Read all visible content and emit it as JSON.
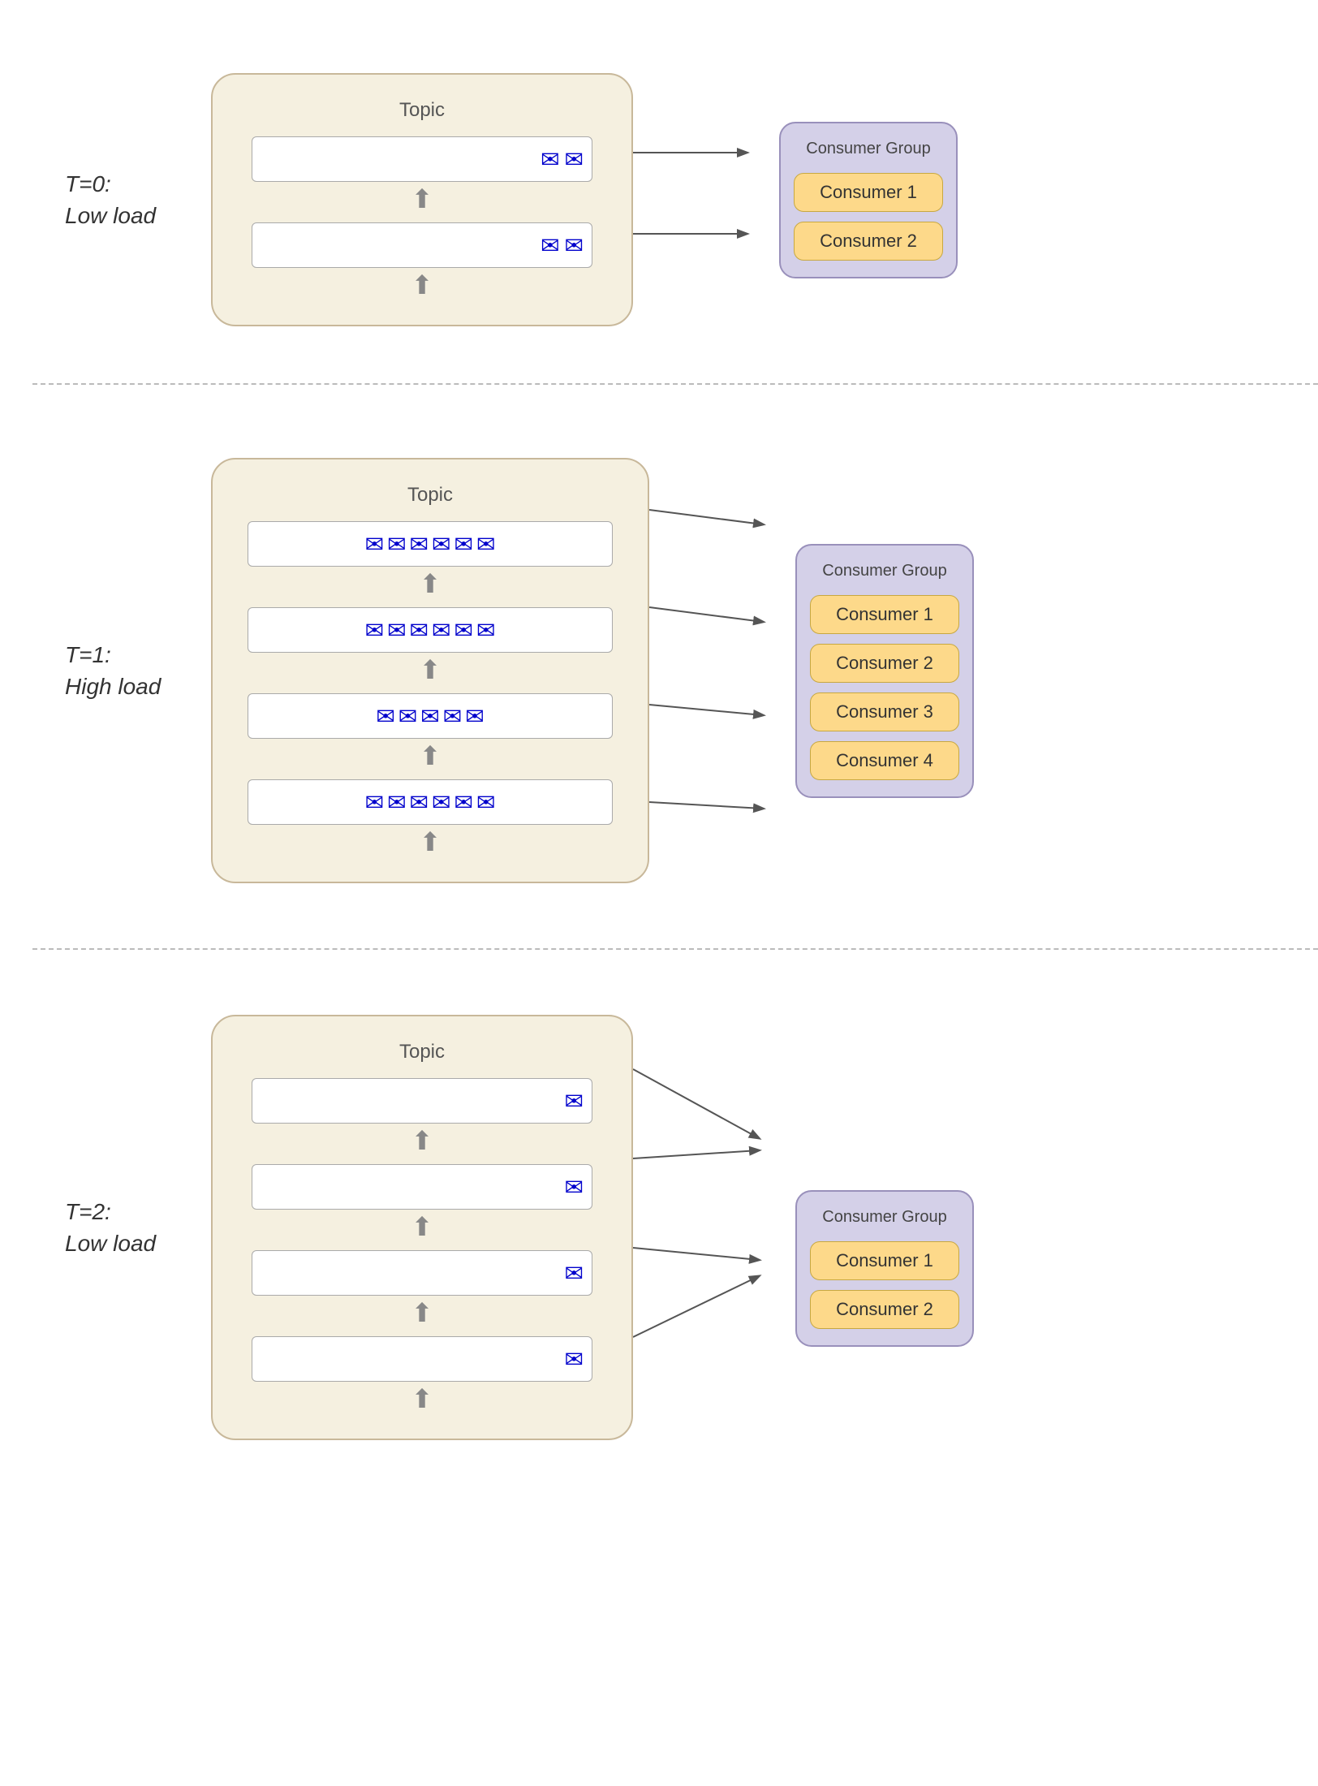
{
  "sections": [
    {
      "id": "t0",
      "label_line1": "T=0:",
      "label_line2": "Low load",
      "topic_title": "Topic",
      "consumer_group_label": "Consumer Group",
      "partitions": [
        {
          "envelopes": 2
        },
        {
          "envelopes": 2
        }
      ],
      "consumers": [
        {
          "label": "Consumer 1"
        },
        {
          "label": "Consumer 2"
        }
      ]
    },
    {
      "id": "t1",
      "label_line1": "T=1:",
      "label_line2": "High load",
      "topic_title": "Topic",
      "consumer_group_label": "Consumer Group",
      "partitions": [
        {
          "envelopes": 6
        },
        {
          "envelopes": 6
        },
        {
          "envelopes": 5
        },
        {
          "envelopes": 6
        }
      ],
      "consumers": [
        {
          "label": "Consumer 1"
        },
        {
          "label": "Consumer 2"
        },
        {
          "label": "Consumer 3"
        },
        {
          "label": "Consumer 4"
        }
      ]
    },
    {
      "id": "t2",
      "label_line1": "T=2:",
      "label_line2": "Low load",
      "topic_title": "Topic",
      "consumer_group_label": "Consumer Group",
      "partitions": [
        {
          "envelopes": 1
        },
        {
          "envelopes": 1
        },
        {
          "envelopes": 1
        },
        {
          "envelopes": 1
        }
      ],
      "consumers": [
        {
          "label": "Consumer 1"
        },
        {
          "label": "Consumer 2"
        }
      ]
    }
  ],
  "divider": "- - - - - - - - - - - - - - - - - - - - - - - - - - - - - - - - - -"
}
